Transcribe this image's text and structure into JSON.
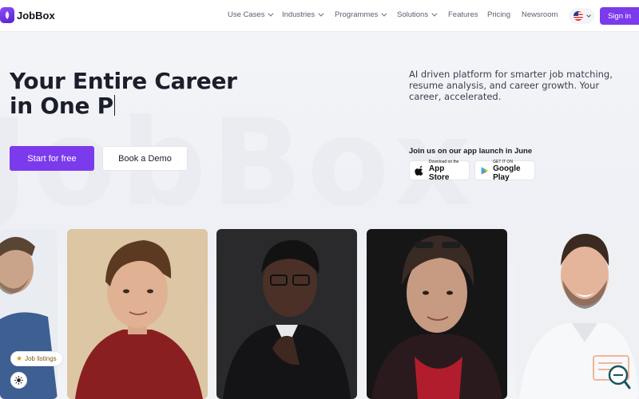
{
  "brand": {
    "name": "JobBox"
  },
  "nav": {
    "items": [
      {
        "label": "Use Cases",
        "dropdown": true
      },
      {
        "label": "Industries",
        "dropdown": true
      },
      {
        "label": "Programmes",
        "dropdown": true
      },
      {
        "label": "Solutions",
        "dropdown": true
      },
      {
        "label": "Features",
        "dropdown": false
      },
      {
        "label": "Pricing",
        "dropdown": false
      },
      {
        "label": "Newsroom",
        "dropdown": false
      }
    ],
    "language_icon": "us-flag-icon",
    "signin_label": "Sign in"
  },
  "hero": {
    "headline_line1": "Your Entire Career",
    "headline_line2": "in One P",
    "primary_cta": "Start for free",
    "secondary_cta": "Book a Demo",
    "tagline": "AI driven platform for smarter job matching, resume analysis, and career growth. Your career, accelerated.",
    "launch_text": "Join us on our app launch in June",
    "app_store": {
      "small": "Download on the",
      "big": "App Store"
    },
    "google_play": {
      "small": "GET IT ON",
      "big": "Google Play"
    }
  },
  "widgets": {
    "job_listings_label": "Job listings",
    "theme_icon": "sun-icon"
  },
  "colors": {
    "accent": "#7c3aed",
    "background": "#f4f5f8"
  }
}
